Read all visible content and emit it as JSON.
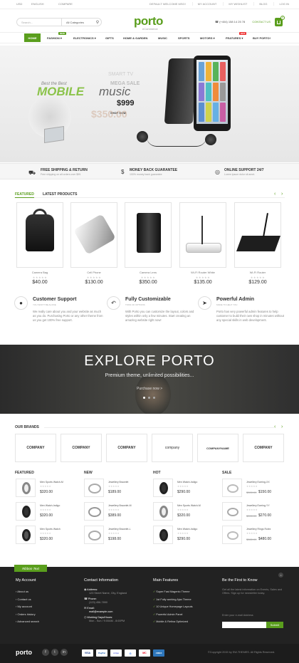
{
  "topbar": {
    "currency": "USD",
    "language": "ENGLISH",
    "compare": "COMPARE",
    "links": [
      "DEFAULT WELCOME MSG!",
      "MY ACCOUNT",
      "MY WISHLIST",
      "BLOG",
      "LOG IN"
    ]
  },
  "header": {
    "search_placeholder": "Search...",
    "category": "All Categories",
    "logo": "porto",
    "logo_sub": "eCommerce",
    "phone": "(+404) 158 14 25 78",
    "contact": "CONTACT US",
    "cart_count": "0"
  },
  "nav": {
    "items": [
      "HOME",
      "FASHION",
      "ELECTRONICS",
      "GIFTS",
      "HOME & GARDEN",
      "MUSIC",
      "SPORTS",
      "MOTORS",
      "FEATURES",
      "BUY PORTO!"
    ],
    "badge_new": "NEW",
    "badge_hot": "HOT"
  },
  "hero": {
    "tag": "Best the Best",
    "headline1": "MOBILE",
    "headline2": "music",
    "smart": "SMART TV",
    "mega": "MEGA SALE",
    "price": "$999",
    "old_price": "$350.00",
    "shop": "SHOP NOW"
  },
  "features_bar": [
    {
      "title": "FREE SHIPPING & RETURN",
      "sub": "Free shipping on all orders over $99."
    },
    {
      "title": "MONEY BACK GUARANTEE",
      "sub": "100% money back guarantee"
    },
    {
      "title": "ONLINE SUPPORT 24/7",
      "sub": "Lorem ipsum dolor sit amet."
    }
  ],
  "products": {
    "tabs": [
      "FEATURED",
      "LATEST PRODUCTS"
    ],
    "items": [
      {
        "name": "Camera Bag",
        "price": "$40.00"
      },
      {
        "name": "Cell Phone",
        "price": "$130.00"
      },
      {
        "name": "Camera Lens",
        "price": "$350.00"
      },
      {
        "name": "Wi-Fi Router White",
        "price": "$135.00"
      },
      {
        "name": "Wi-Fi Router",
        "price": "$129.00"
      }
    ]
  },
  "info_blocks": [
    {
      "title": "Customer Support",
      "sub": "YOU WON'T BE ALONE",
      "text": "We really care about you and your website as much as you do. Purchasing Porto or any other theme from us you get 100% free support."
    },
    {
      "title": "Fully Customizable",
      "sub": "TONS OF OPTIONS",
      "text": "With Porto you can customize the layout, colors and styles within only a few minutes. Start creating an amazing website right now!"
    },
    {
      "title": "Powerful Admin",
      "sub": "MADE TO HELP YOU",
      "text": "Porto has very powerful admin features to help customer to build their own shop in minutes without any special skills in web development."
    }
  ],
  "explore": {
    "title": "EXPLORE PORTO",
    "sub": "Premium theme, unlimited possibilities...",
    "cta": "Purchase now >"
  },
  "brands": {
    "title": "OUR BRANDS",
    "items": [
      "COMPANY",
      "COMPANY",
      "COMPANY",
      "company",
      "COMPANYNAME",
      "COMPANY"
    ]
  },
  "columns": [
    {
      "title": "FEATURED",
      "items": [
        {
          "name": "Men Sports Watch-M",
          "price": "$320.00"
        },
        {
          "name": "Men Watch-Indigo",
          "price": "$320.00"
        },
        {
          "name": "Men Sports Watch",
          "price": "$320.00"
        }
      ]
    },
    {
      "title": "NEW",
      "items": [
        {
          "name": "Jewellery Bracelet",
          "price": "$189.00"
        },
        {
          "name": "Jewellery Bracelet-M",
          "price": "$389.00"
        },
        {
          "name": "Jewellery Bracelet-L",
          "price": "$198.00"
        }
      ]
    },
    {
      "title": "HOT",
      "items": [
        {
          "name": "Men Watch-Indigo",
          "price": "$290.00"
        },
        {
          "name": "Men Sports Watch-M",
          "price": "$320.00"
        },
        {
          "name": "Men Watch-Indigo",
          "price": "$290.00"
        }
      ]
    },
    {
      "title": "SALE",
      "items": [
        {
          "name": "Jewellery Earring-XX",
          "old": "$300.00",
          "price": "$150.00"
        },
        {
          "name": "Jewellery Earring-YY",
          "old": "$390.00",
          "price": "$270.00"
        },
        {
          "name": "Jewellery Rings Rolex",
          "old": "$580.00",
          "price": "$480.00"
        }
      ]
    }
  ],
  "footer": {
    "ribbon": "Ribbon Text",
    "account_title": "My Account",
    "account_links": [
      "About us",
      "Contact us",
      "My account",
      "Orders history",
      "Advanced search"
    ],
    "contact_title": "Contact Information",
    "address_label": "Address:",
    "address": "123 Street Name, City, England",
    "phone_label": "Phone:",
    "phone": "(123) 456-7890",
    "email_label": "Email:",
    "email": "mail@example.com",
    "hours_label": "Working Days/Hours:",
    "hours": "Mon - Sun / 9:00AM - 8:00PM",
    "features_title": "Main Features",
    "features": [
      "Super Fast Magento Theme",
      "1st Fully working Ajax Theme",
      "10 Unique Homepage Layouts",
      "Powerful Admin Panel",
      "Mobile & Retina Optimized"
    ],
    "newsletter_title": "Be the First to Know",
    "newsletter_text": "Get all the latest information on Events, Sales and Offers. Sign up for newsletter today.",
    "newsletter_placeholder": "Enter your e-mail Address",
    "submit": "Submit",
    "logo": "porto",
    "copyright": "©Copyright 2015 by SW-THEMES. All Rights Reserved.",
    "payments": [
      "VISA",
      "PayPal",
      "stripe",
      "G",
      "MC",
      "AMEX"
    ]
  },
  "colors": {
    "accent": "#5a9e1d",
    "dark": "#222222"
  }
}
